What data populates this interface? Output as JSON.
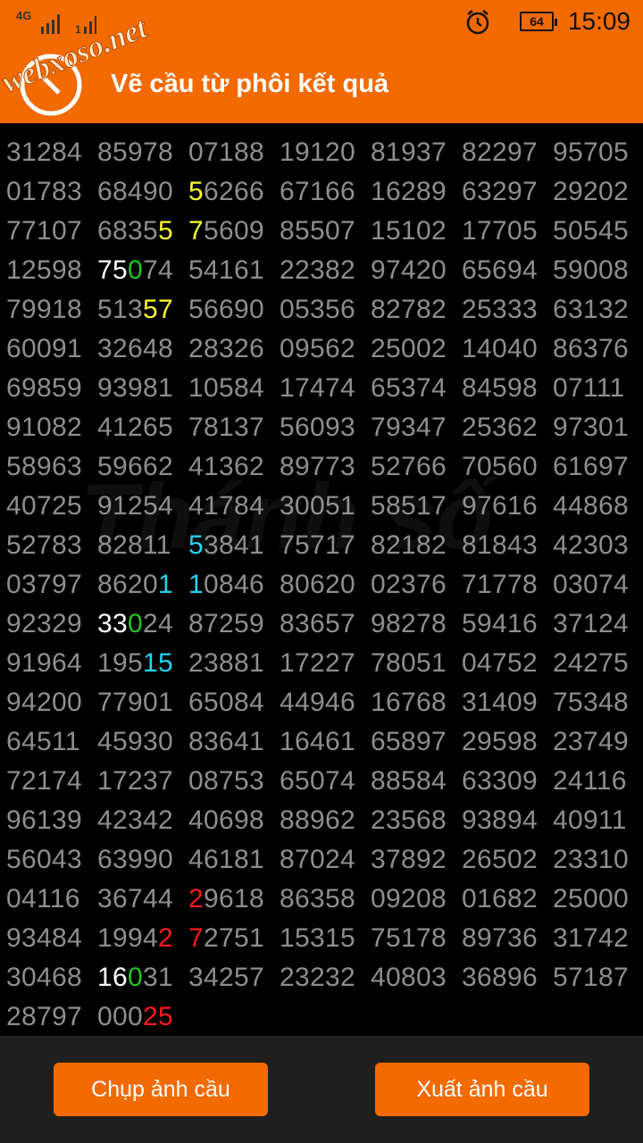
{
  "status_bar": {
    "network_label": "4G",
    "sim_label": "1",
    "battery": "64",
    "time": "15:09"
  },
  "watermark_site": "webxoso.net",
  "app_bar": {
    "title": "Vẽ cầu từ phôi kết quả"
  },
  "background_watermark": "Thánh số",
  "grid_rows": [
    [
      "31284",
      "85978",
      "07188",
      "19120",
      "81937",
      "82297",
      "95705"
    ],
    [
      "01783",
      "68490",
      "56266",
      "67166",
      "16289",
      "63297",
      "29202"
    ],
    [
      "77107",
      "68355",
      "75609",
      "85507",
      "15102",
      "17705",
      "50545"
    ],
    [
      "12598",
      "75074",
      "54161",
      "22382",
      "97420",
      "65694",
      "59008"
    ],
    [
      "79918",
      "51357",
      "56690",
      "05356",
      "82782",
      "25333",
      "63132"
    ],
    [
      "60091",
      "32648",
      "28326",
      "09562",
      "25002",
      "14040",
      "86376"
    ],
    [
      "69859",
      "93981",
      "10584",
      "17474",
      "65374",
      "84598",
      "07111"
    ],
    [
      "91082",
      "41265",
      "78137",
      "56093",
      "79347",
      "25362",
      "97301"
    ],
    [
      "58963",
      "59662",
      "41362",
      "89773",
      "52766",
      "70560",
      "61697"
    ],
    [
      "40725",
      "91254",
      "41784",
      "30051",
      "58517",
      "97616",
      "44868"
    ],
    [
      "52783",
      "82811",
      "53841",
      "75717",
      "82182",
      "81843",
      "42303"
    ],
    [
      "03797",
      "86201",
      "10846",
      "80620",
      "02376",
      "71778",
      "03074"
    ],
    [
      "92329",
      "33024",
      "87259",
      "83657",
      "98278",
      "59416",
      "37124"
    ],
    [
      "91964",
      "19515",
      "23881",
      "17227",
      "78051",
      "04752",
      "24275"
    ],
    [
      "94200",
      "77901",
      "65084",
      "44946",
      "16768",
      "31409",
      "75348"
    ],
    [
      "64511",
      "45930",
      "83641",
      "16461",
      "65897",
      "29598",
      "23749"
    ],
    [
      "72174",
      "17237",
      "08753",
      "65074",
      "88584",
      "63309",
      "24116"
    ],
    [
      "96139",
      "42342",
      "40698",
      "88962",
      "23568",
      "93894",
      "40911"
    ],
    [
      "56043",
      "63990",
      "46181",
      "87024",
      "37892",
      "26502",
      "23310"
    ],
    [
      "04116",
      "36744",
      "29618",
      "86358",
      "09208",
      "01682",
      "25000"
    ],
    [
      "93484",
      "19942",
      "72751",
      "15315",
      "75178",
      "89736",
      "31742"
    ],
    [
      "30468",
      "16031",
      "34257",
      "23232",
      "40803",
      "36896",
      "57187"
    ],
    [
      "28797",
      "00025"
    ]
  ],
  "highlights": [
    {
      "row": 1,
      "col": 2,
      "pos": 0,
      "color": "yellow"
    },
    {
      "row": 2,
      "col": 1,
      "pos": 4,
      "color": "yellow"
    },
    {
      "row": 2,
      "col": 2,
      "pos": 0,
      "color": "yellow"
    },
    {
      "row": 3,
      "col": 1,
      "pos": 0,
      "color": "white"
    },
    {
      "row": 3,
      "col": 1,
      "pos": 1,
      "color": "white"
    },
    {
      "row": 3,
      "col": 1,
      "pos": 2,
      "color": "green"
    },
    {
      "row": 4,
      "col": 1,
      "pos": 3,
      "color": "yellow"
    },
    {
      "row": 4,
      "col": 1,
      "pos": 4,
      "color": "yellow"
    },
    {
      "row": 10,
      "col": 2,
      "pos": 0,
      "color": "cyan"
    },
    {
      "row": 11,
      "col": 1,
      "pos": 4,
      "color": "cyan"
    },
    {
      "row": 11,
      "col": 2,
      "pos": 0,
      "color": "cyan"
    },
    {
      "row": 12,
      "col": 1,
      "pos": 0,
      "color": "white"
    },
    {
      "row": 12,
      "col": 1,
      "pos": 1,
      "color": "white"
    },
    {
      "row": 12,
      "col": 1,
      "pos": 2,
      "color": "green"
    },
    {
      "row": 13,
      "col": 1,
      "pos": 3,
      "color": "cyan"
    },
    {
      "row": 13,
      "col": 1,
      "pos": 4,
      "color": "cyan"
    },
    {
      "row": 19,
      "col": 2,
      "pos": 0,
      "color": "red"
    },
    {
      "row": 20,
      "col": 1,
      "pos": 4,
      "color": "red"
    },
    {
      "row": 20,
      "col": 2,
      "pos": 0,
      "color": "red"
    },
    {
      "row": 21,
      "col": 1,
      "pos": 0,
      "color": "white"
    },
    {
      "row": 21,
      "col": 1,
      "pos": 1,
      "color": "white"
    },
    {
      "row": 21,
      "col": 1,
      "pos": 2,
      "color": "green"
    },
    {
      "row": 22,
      "col": 1,
      "pos": 3,
      "color": "red"
    },
    {
      "row": 22,
      "col": 1,
      "pos": 4,
      "color": "red"
    }
  ],
  "colors": {
    "accent": "#f26a00",
    "digit_default": "#8e8e8e",
    "white": "#ffffff",
    "yellow": "#ffff2e",
    "green": "#22c322",
    "cyan": "#24d4f2",
    "red": "#ff1a1a"
  },
  "footer": {
    "capture_button": "Chụp ảnh cầu",
    "export_button": "Xuất ảnh cầu"
  }
}
